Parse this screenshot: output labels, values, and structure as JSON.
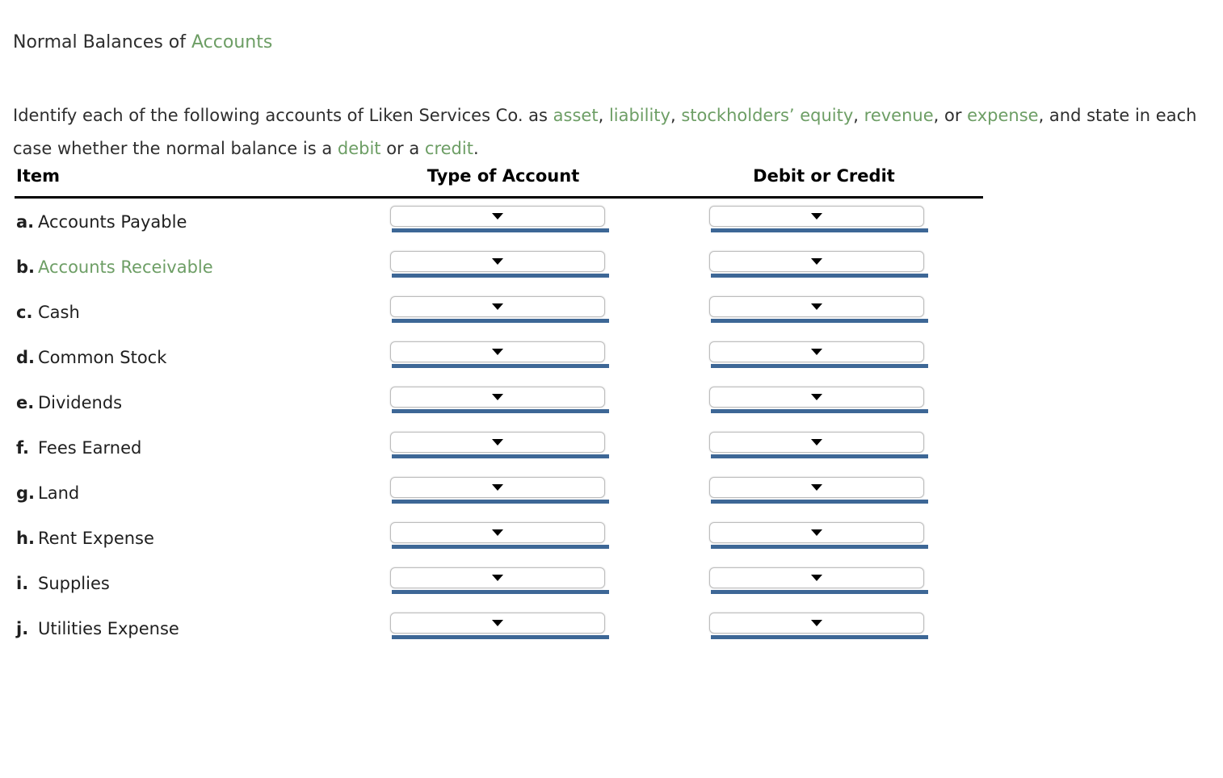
{
  "page": {
    "title_plain": "Normal Balances of ",
    "title_accent": "Accounts",
    "accent_color": "#6d9e65",
    "underline_color": "#3d6796"
  },
  "instructions": {
    "seg1": "Identify each of the following accounts of Liken Services Co. as ",
    "term_asset": "asset",
    "sep1": ", ",
    "term_liability": "liability",
    "sep2": ", ",
    "term_equity": "stockholders’ equity",
    "sep3": ", ",
    "term_revenue": "revenue",
    "sep4": ", or ",
    "term_expense": "expense",
    "sep5": ", and state in each case whether the normal balance is a ",
    "term_debit": "debit",
    "sep6": " or a ",
    "term_credit": "credit",
    "sep7": "."
  },
  "table": {
    "headers": {
      "item": "Item",
      "type_of_account": "Type of Account",
      "debit_or_credit": "Debit or Credit"
    },
    "dropdown_icon": "chevron-down-icon",
    "rows": [
      {
        "letter": "a.",
        "label": "Accounts Payable",
        "highlight": false,
        "type_value": "",
        "debit_value": ""
      },
      {
        "letter": "b.",
        "label": "Accounts Receivable",
        "highlight": true,
        "type_value": "",
        "debit_value": ""
      },
      {
        "letter": "c.",
        "label": "Cash",
        "highlight": false,
        "type_value": "",
        "debit_value": ""
      },
      {
        "letter": "d.",
        "label": "Common Stock",
        "highlight": false,
        "type_value": "",
        "debit_value": ""
      },
      {
        "letter": "e.",
        "label": "Dividends",
        "highlight": false,
        "type_value": "",
        "debit_value": ""
      },
      {
        "letter": "f.",
        "label": "Fees Earned",
        "highlight": false,
        "type_value": "",
        "debit_value": ""
      },
      {
        "letter": "g.",
        "label": "Land",
        "highlight": false,
        "type_value": "",
        "debit_value": ""
      },
      {
        "letter": "h.",
        "label": "Rent Expense",
        "highlight": false,
        "type_value": "",
        "debit_value": ""
      },
      {
        "letter": "i.",
        "label": "Supplies",
        "highlight": false,
        "type_value": "",
        "debit_value": ""
      },
      {
        "letter": "j.",
        "label": "Utilities Expense",
        "highlight": false,
        "type_value": "",
        "debit_value": ""
      }
    ]
  }
}
